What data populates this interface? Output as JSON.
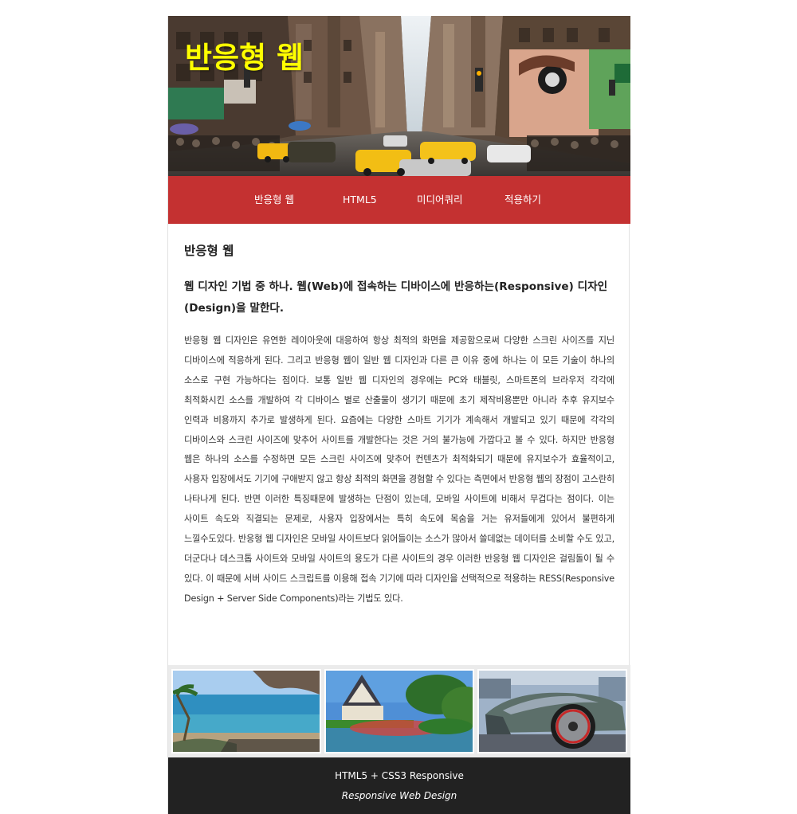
{
  "header": {
    "title": "반응형 웹"
  },
  "nav": {
    "items": [
      "반응형 웹",
      "HTML5",
      "미디어쿼리",
      "적용하기"
    ]
  },
  "content": {
    "heading": "반응형 웹",
    "subheading": "웹 디자인 기법 중 하나. 웹(Web)에 접속하는 디바이스에 반응하는(Responsive) 디자인(Design)을 말한다.",
    "body": "반응형 웹 디자인은 유연한 레이아웃에 대응하여 항상 최적의 화면을 제공함으로써 다양한 스크린 사이즈를 지닌 디바이스에 적응하게 된다. 그리고 반응형 웹이 일반 웹 디자인과 다른 큰 이유 중에 하나는 이 모든 기술이 하나의 소스로 구현 가능하다는 점이다. 보통 일반 웹 디자인의 경우에는 PC와 태블릿, 스마트폰의 브라우저 각각에 최적화시킨 소스를 개발하여 각 디바이스 별로 산출물이 생기기 때문에 초기 제작비용뿐만 아니라 추후 유지보수 인력과 비용까지 추가로 발생하게 된다. 요즘에는 다양한 스마트 기기가 계속해서 개발되고 있기 때문에 각각의 디바이스와 스크린 사이즈에 맞추어 사이트를 개발한다는 것은 거의 불가능에 가깝다고 볼 수 있다. 하지만 반응형 웹은 하나의 소스를 수정하면 모든 스크린 사이즈에 맞추어 컨텐츠가 최적화되기 때문에 유지보수가 효율적이고, 사용자 입장에서도 기기에 구애받지 않고 항상 최적의 화면을 경험할 수 있다는 측면에서 반응형 웹의 장점이 고스란히 나타나게 된다. 반면 이러한 특징때문에 발생하는 단점이 있는데, 모바일 사이트에 비해서 무겁다는 점이다. 이는 사이트 속도와 직결되는 문제로, 사용자 입장에서는 특히 속도에 목숨을 거는 유저들에게 있어서 불편하게 느낄수도있다. 반응형 웹 디자인은 모바일 사이트보다 읽어들이는 소스가 많아서 쓸데없는 데이터를 소비할 수도 있고, 더군다나 데스크톱 사이트와 모바일 사이트의 용도가 다른 사이트의 경우 이러한 반응형 웹 디자인은 걸림돌이 될 수 있다. 이 때문에 서버 사이드 스크립트를 이용해 접속 기기에 따라 디자인을 선택적으로 적용하는 RESS(Responsive Design + Server Side Components)라는 기법도 있다."
  },
  "gallery": {
    "images": [
      "beach-photo",
      "temple-photo",
      "sports-car-photo"
    ]
  },
  "footer": {
    "line1": "HTML5 + CSS3 Responsive",
    "line2": "Responsive Web Design"
  },
  "colors": {
    "nav_background": "#c43131",
    "title_color": "#ffff00",
    "footer_background": "#222222",
    "gallery_background": "#ebebeb"
  }
}
